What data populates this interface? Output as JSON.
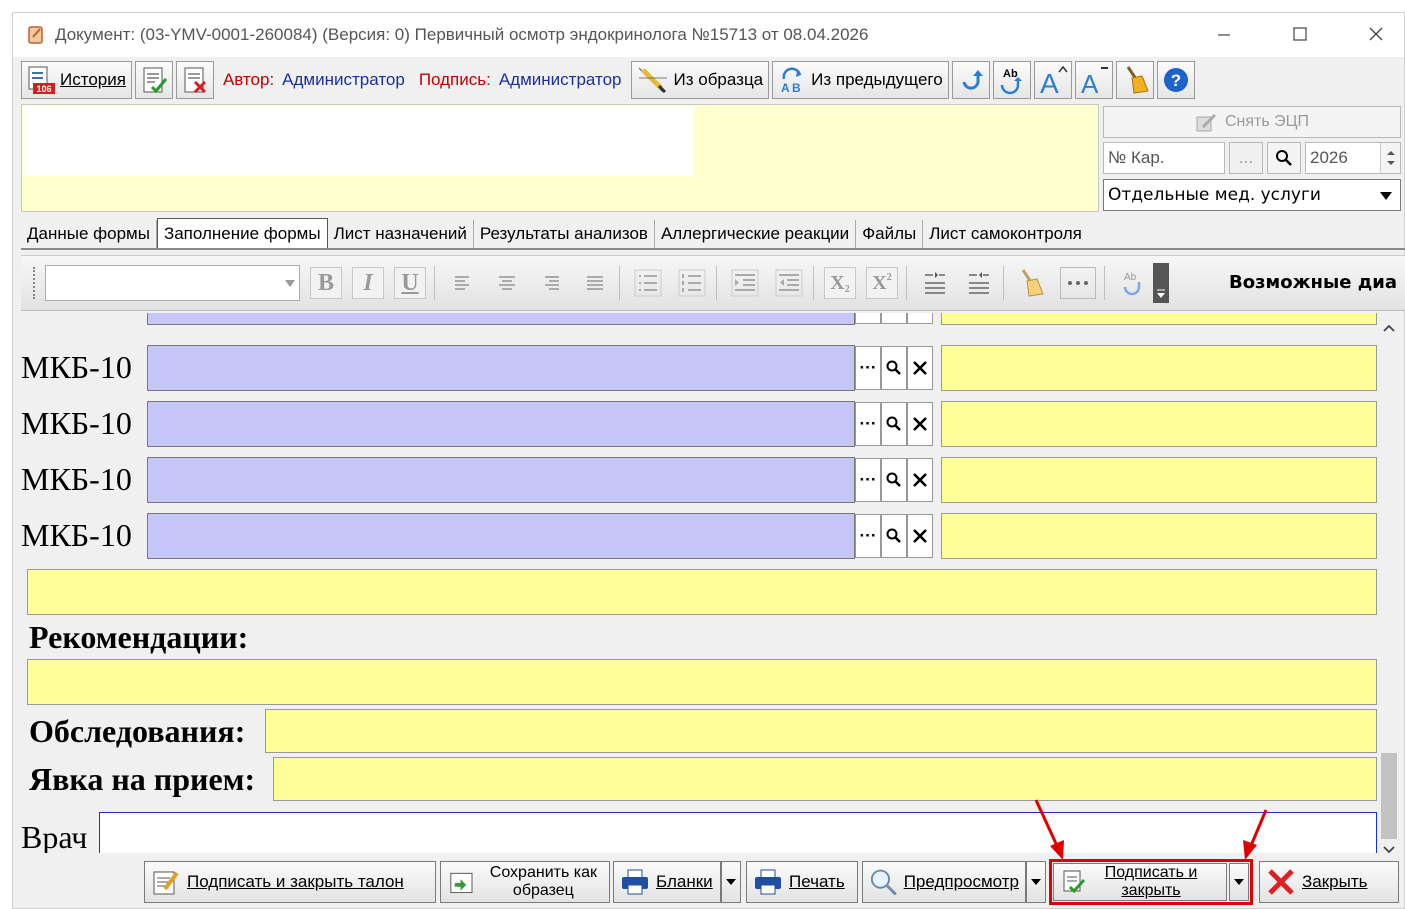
{
  "window": {
    "title": "Документ: (03-YMV-0001-260084) (Версия: 0) Первичный осмотр эндокринолога №15713 от 08.04.2026"
  },
  "toolbar": {
    "history_label": "История",
    "history_badge": "106",
    "author_label": "Автор:",
    "author_value": "Администратор",
    "sign_label": "Подпись:",
    "sign_value": "Администратор",
    "from_sample_label": "Из образца",
    "from_previous_label": "Из предыдущего"
  },
  "header": {
    "remove_ecp_label": "Снять ЭЦП",
    "card_placeholder": "№ Кар.",
    "ellipsis": "...",
    "year_value": "2026",
    "services_select": "Отдельные мед. услуги"
  },
  "tabs": [
    {
      "label": "Данные формы"
    },
    {
      "label": "Заполнение формы"
    },
    {
      "label": "Лист назначений"
    },
    {
      "label": "Результаты анализов"
    },
    {
      "label": "Аллергические реакции"
    },
    {
      "label": "Файлы"
    },
    {
      "label": "Лист самоконтроля"
    }
  ],
  "format_toolbar": {
    "bold": "B",
    "italic": "I",
    "underline": "U",
    "subscript": "X",
    "superscript": "X",
    "possible_diag_label": "Возможные диа"
  },
  "form": {
    "mkb_label": "МКБ-10",
    "mkb_btn_more": "···",
    "recommendations_label": "Рекомендации:",
    "examinations_label": "Обследования:",
    "appointment_label": "Явка на прием:",
    "doctor_label": "Врач"
  },
  "bottom": {
    "sign_close_ticket_label": "Подписать и закрыть талон",
    "save_as_sample_label": "Сохранить как образец",
    "forms_label": "Бланки",
    "print_label": "Печать",
    "preview_label": "Предпросмотр",
    "sign_close_label": "Подписать и закрыть",
    "close_label": "Закрыть"
  },
  "colors": {
    "yellow_field": "#ffff99",
    "mkb_field": "#c6c6f8",
    "highlight": "#e00000"
  }
}
